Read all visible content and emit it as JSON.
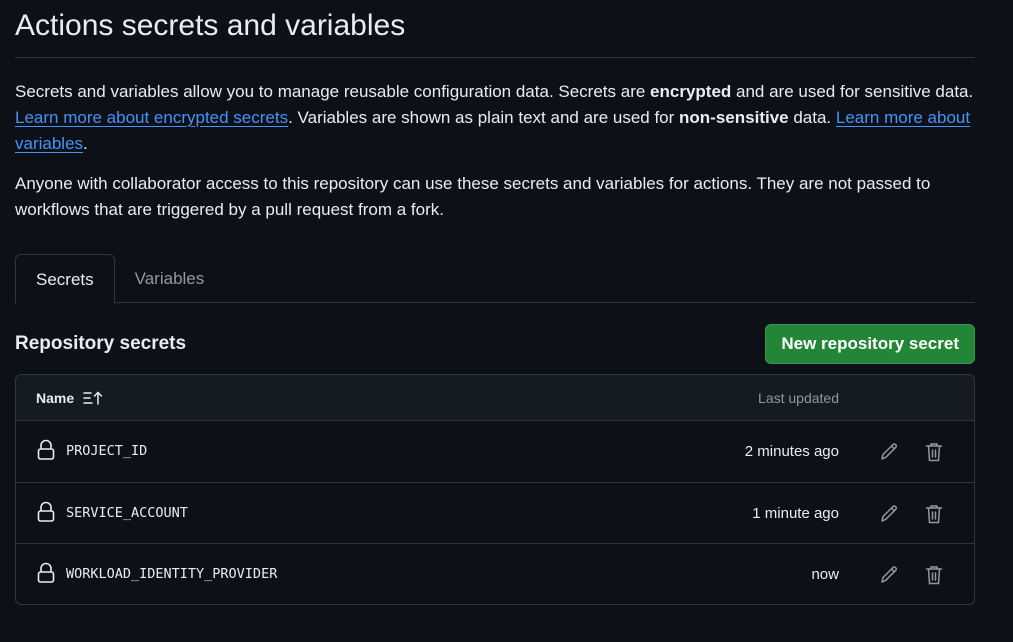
{
  "page": {
    "title": "Actions secrets and variables"
  },
  "intro": {
    "p1_a": "Secrets and variables allow you to manage reusable configuration data. Secrets are ",
    "p1_b": "encrypted",
    "p1_c": " and are used for sensitive data. ",
    "p1_link1": "Learn more about encrypted secrets",
    "p1_d": ". Variables are shown as plain text and are used for ",
    "p1_e": "non-sensitive",
    "p1_f": " data. ",
    "p1_link2": "Learn more about variables",
    "p1_g": ".",
    "p2": "Anyone with collaborator access to this repository can use these secrets and variables for actions. They are not passed to workflows that are triggered by a pull request from a fork."
  },
  "tabs": [
    {
      "label": "Secrets",
      "active": true
    },
    {
      "label": "Variables",
      "active": false
    }
  ],
  "section": {
    "title": "Repository secrets",
    "new_button": "New repository secret"
  },
  "table": {
    "col_name": "Name",
    "col_updated": "Last updated",
    "sort_icon": "sort-asc-icon",
    "rows": [
      {
        "name": "PROJECT_ID",
        "updated": "2 minutes ago"
      },
      {
        "name": "SERVICE_ACCOUNT",
        "updated": "1 minute ago"
      },
      {
        "name": "WORKLOAD_IDENTITY_PROVIDER",
        "updated": "now"
      }
    ]
  },
  "colors": {
    "background": "#0d1117",
    "text": "#e6edf3",
    "muted": "#9198a1",
    "link": "#4493f8",
    "border": "#30363d",
    "button_green": "#238636"
  }
}
